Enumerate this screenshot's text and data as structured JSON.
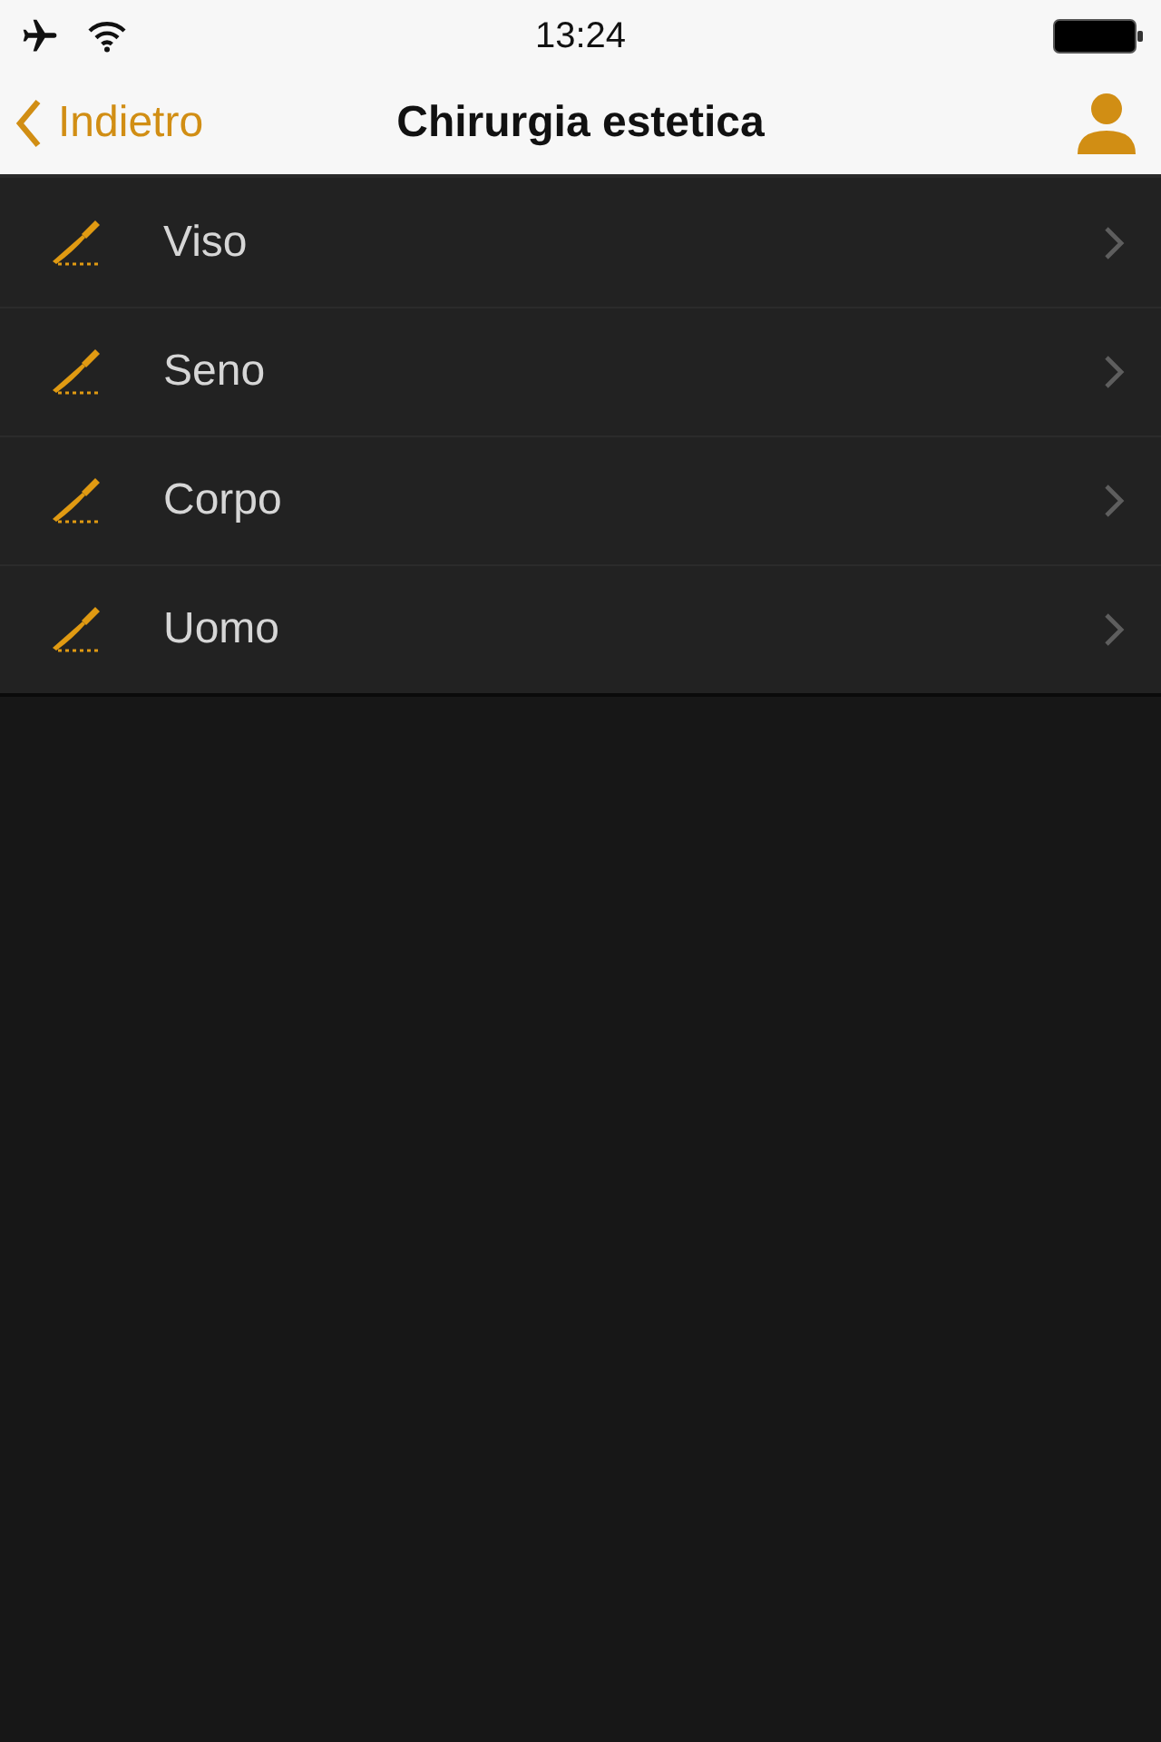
{
  "status_bar": {
    "time": "13:24"
  },
  "nav_bar": {
    "back_label": "Indietro",
    "title": "Chirurgia estetica"
  },
  "list": {
    "items": [
      {
        "label": "Viso"
      },
      {
        "label": "Seno"
      },
      {
        "label": "Corpo"
      },
      {
        "label": "Uomo"
      }
    ]
  }
}
